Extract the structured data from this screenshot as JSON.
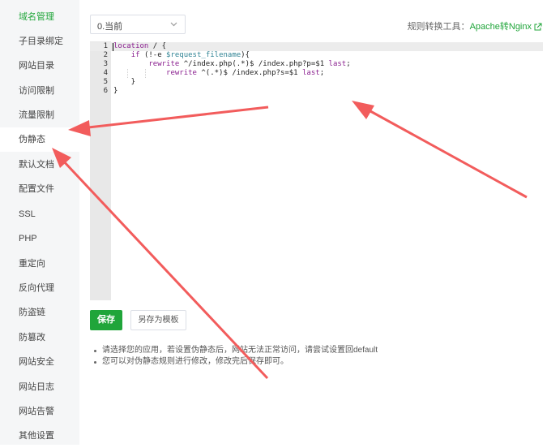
{
  "sidebar": {
    "items": [
      {
        "label": "域名管理",
        "active": true
      },
      {
        "label": "子目录绑定"
      },
      {
        "label": "网站目录"
      },
      {
        "label": "访问限制"
      },
      {
        "label": "流量限制"
      },
      {
        "label": "伪静态",
        "highlighted": true
      },
      {
        "label": "默认文档"
      },
      {
        "label": "配置文件"
      },
      {
        "label": "SSL"
      },
      {
        "label": "PHP"
      },
      {
        "label": "重定向"
      },
      {
        "label": "反向代理"
      },
      {
        "label": "防盗链"
      },
      {
        "label": "防篡改"
      },
      {
        "label": "网站安全"
      },
      {
        "label": "网站日志"
      },
      {
        "label": "网站告警"
      },
      {
        "label": "其他设置"
      }
    ]
  },
  "toolbar": {
    "select_value": "0.当前",
    "tool_label": "规则转换工具：",
    "tool_link": "Apache转Nginx"
  },
  "editor": {
    "line_numbers": [
      "1",
      "2",
      "3",
      "4",
      "5",
      "6"
    ],
    "lines": [
      "location / {",
      "    if (!-e $request_filename){",
      "        rewrite ^/index.php(.*)$ /index.php?p=$1 last;",
      "            rewrite ^(.*)$ /index.php?s=$1 last;",
      "    }",
      "}"
    ]
  },
  "actions": {
    "save_label": "保存",
    "save_template_label": "另存为模板"
  },
  "tips": [
    "请选择您的应用，若设置伪静态后，网站无法正常访问，请尝试设置回default",
    "您可以对伪静态规则进行修改，修改完后保存即可。"
  ],
  "colors": {
    "accent": "#20a53a",
    "annotation_arrow": "#f25c5c",
    "sidebar_bg": "#f5f6f7"
  }
}
